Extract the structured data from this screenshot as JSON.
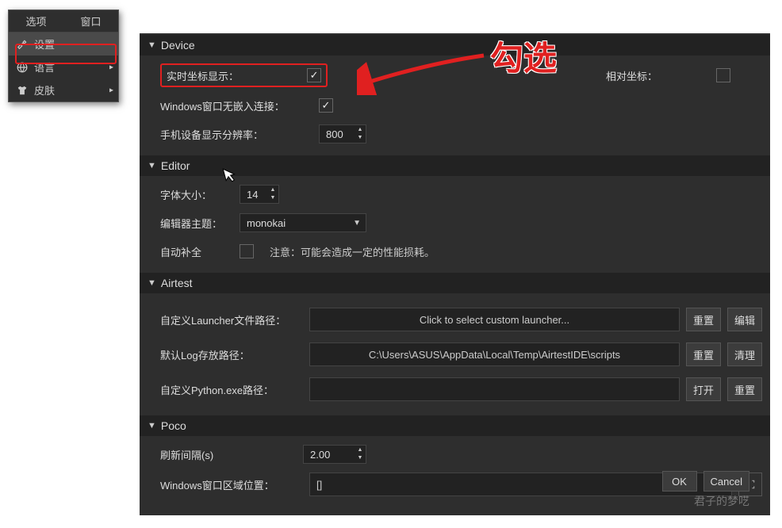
{
  "menubar": {
    "top": [
      "选项",
      "窗口"
    ],
    "items": [
      {
        "label": "设置",
        "icon": "wrench-icon",
        "arrow": false,
        "active": true
      },
      {
        "label": "语言",
        "icon": "globe-icon",
        "arrow": true,
        "active": false
      },
      {
        "label": "皮肤",
        "icon": "shirt-icon",
        "arrow": true,
        "active": false
      }
    ]
  },
  "annotation": "勾选",
  "sections": {
    "device": {
      "title": "Device",
      "realtime_coord_label": "实时坐标显示：",
      "realtime_coord_checked": true,
      "relative_coord_label": "相对坐标：",
      "relative_coord_checked": false,
      "no_embed_label": "Windows窗口无嵌入连接：",
      "no_embed_checked": true,
      "resolution_label": "手机设备显示分辨率：",
      "resolution_value": "800"
    },
    "editor": {
      "title": "Editor",
      "font_label": "字体大小：",
      "font_value": "14",
      "theme_label": "编辑器主题：",
      "theme_value": "monokai",
      "autocomplete_label": "自动补全",
      "autocomplete_checked": false,
      "autocomplete_note": "注意：可能会造成一定的性能损耗。"
    },
    "airtest": {
      "title": "Airtest",
      "launcher_label": "自定义Launcher文件路径：",
      "launcher_placeholder": "Click to select custom launcher...",
      "launcher_btn_reset": "重置",
      "launcher_btn_edit": "编辑",
      "log_label": "默认Log存放路径：",
      "log_value": "C:\\Users\\ASUS\\AppData\\Local\\Temp\\AirtestIDE\\scripts",
      "log_btn_reset": "重置",
      "log_btn_clean": "清理",
      "python_label": "自定义Python.exe路径：",
      "python_value": "",
      "python_btn_open": "打开",
      "python_btn_reset": "重置"
    },
    "poco": {
      "title": "Poco",
      "refresh_label": "刷新间隔(s)",
      "refresh_value": "2.00",
      "area_label": "Windows窗口区域位置：",
      "area_value": "[]"
    }
  },
  "footer": {
    "ok": "OK",
    "cancel": "Cancel",
    "watermark": "君子的梦呓"
  }
}
